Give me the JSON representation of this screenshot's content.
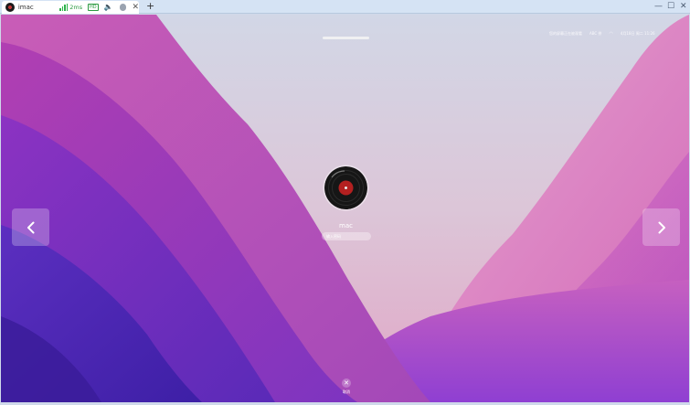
{
  "viewer": {
    "tab_title": "imac",
    "latency": "2ms",
    "quality_badge": "HD",
    "new_tab_label": "+",
    "close_tab_label": "✕",
    "window_controls": {
      "minimize": "—",
      "maximize": "☐",
      "close": "✕"
    },
    "icons": [
      "avatar-icon",
      "signal-icon",
      "speaker-icon",
      "settings-icon"
    ],
    "accent_color": "#2db34a"
  },
  "menubar": {
    "status_text": "您的屏幕正在被观看",
    "input_source": "ABC 拼",
    "datetime": "4月18日 周二 11:26"
  },
  "login": {
    "username": "mac",
    "password_placeholder": "输入密码"
  },
  "navigation": {
    "previous_icon": "chevron-left-icon",
    "next_icon": "chevron-right-icon"
  },
  "cancel": {
    "label": "取消",
    "icon_glyph": "✕"
  }
}
